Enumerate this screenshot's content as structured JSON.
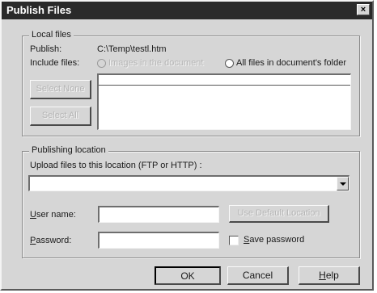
{
  "window": {
    "title": "Publish Files",
    "close_glyph": "×"
  },
  "local_files": {
    "legend": "Local files",
    "publish_label": "Publish:",
    "publish_path": "C:\\Temp\\testl.htm",
    "include_label": "Include files:",
    "option_images": "Images in the document",
    "option_all": "All files in document's folder",
    "select_none": "Select None",
    "select_all": "Select All"
  },
  "publishing": {
    "legend": "Publishing location",
    "upload_label": "Upload files to this location (FTP or HTTP) :",
    "upload_value": "",
    "user_label_u": "U",
    "user_label_rest": "ser name:",
    "user_value": "",
    "use_default": "Use Default Location",
    "password_label_u": "P",
    "password_label_rest": "assword:",
    "password_value": "",
    "save_pw_u": "S",
    "save_pw_rest": "ave password"
  },
  "buttons": {
    "ok": "OK",
    "cancel": "Cancel",
    "help_u": "H",
    "help_rest": "elp"
  }
}
